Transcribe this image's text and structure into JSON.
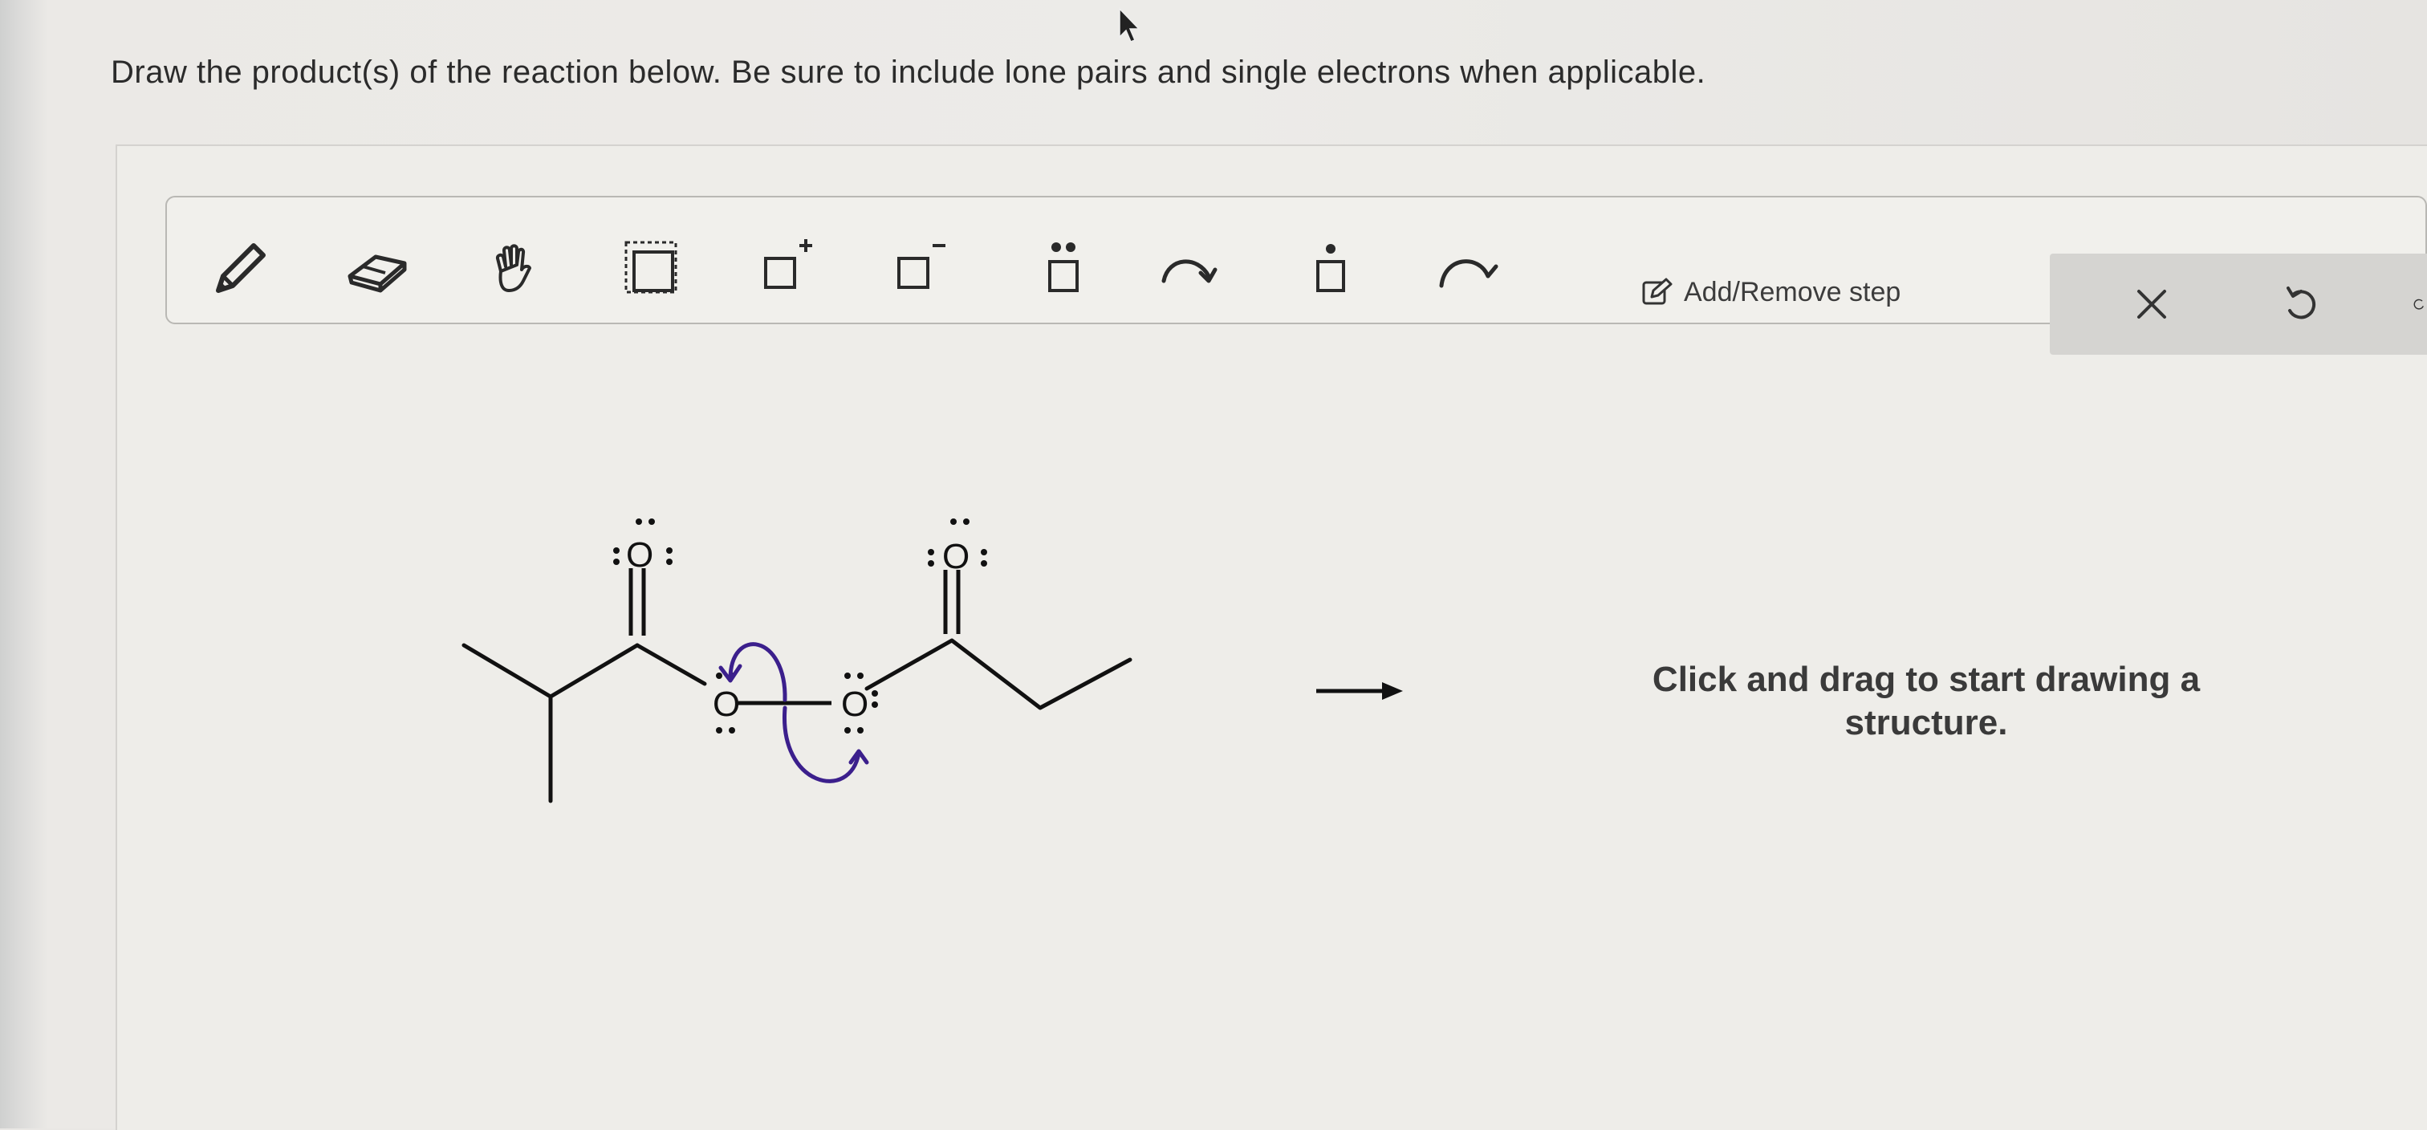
{
  "question": {
    "text": "Draw the product(s) of the reaction below. Be sure to include lone pairs and single electrons when applicable."
  },
  "toolbar": {
    "tools": [
      {
        "name": "pencil-tool",
        "icon": "pencil-icon"
      },
      {
        "name": "eraser-tool",
        "icon": "eraser-icon"
      },
      {
        "name": "hand-tool",
        "icon": "hand-icon"
      },
      {
        "name": "selection-tool",
        "icon": "dashed-square-icon"
      },
      {
        "name": "positive-charge-tool",
        "icon": "square-plus-icon"
      },
      {
        "name": "negative-charge-tool",
        "icon": "square-minus-icon"
      },
      {
        "name": "lone-pair-tool",
        "icon": "square-lone-pair-icon"
      },
      {
        "name": "electron-pair-arrow-tool",
        "icon": "curved-arrow-icon"
      },
      {
        "name": "single-electron-tool",
        "icon": "square-single-dot-icon"
      },
      {
        "name": "single-electron-arrow-tool",
        "icon": "half-arrow-icon"
      }
    ],
    "add_remove_label": "Add/Remove step",
    "clear_icon": "close-icon",
    "undo_icon": "undo-icon"
  },
  "reaction": {
    "atoms": {
      "oxygen": "O"
    },
    "arrow": "→"
  },
  "canvas": {
    "hint": "Click and drag to start drawing a structure."
  },
  "colors": {
    "arrow_purple": "#3b1f8c",
    "text": "#2b2b2b"
  }
}
